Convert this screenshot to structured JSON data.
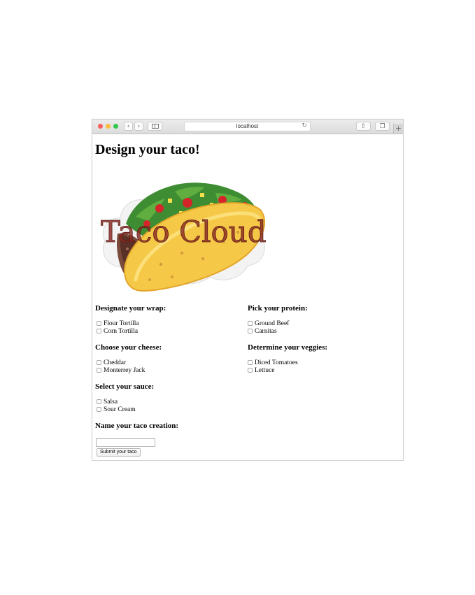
{
  "browser": {
    "address": "localhost",
    "icons": [
      "back-icon",
      "forward-icon",
      "sidebar-icon",
      "reload-icon",
      "share-icon",
      "tabs-icon",
      "new-tab-icon"
    ]
  },
  "page": {
    "title": "Design your taco!",
    "logo_text": "Taco Cloud",
    "sections": {
      "wrap": {
        "heading": "Designate your wrap:",
        "options": [
          "Flour Tortilla",
          "Corn Tortilla"
        ]
      },
      "protein": {
        "heading": "Pick your protein:",
        "options": [
          "Ground Beef",
          "Carnitas"
        ]
      },
      "cheese": {
        "heading": "Choose your cheese:",
        "options": [
          "Cheddar",
          "Monterrey Jack"
        ]
      },
      "veggies": {
        "heading": "Determine your veggies:",
        "options": [
          "Diced Tomatoes",
          "Lettuce"
        ]
      },
      "sauce": {
        "heading": "Select your sauce:",
        "options": [
          "Salsa",
          "Sour Cream"
        ]
      }
    },
    "name_heading": "Name your taco creation:",
    "name_value": "",
    "submit_label": "Submit your taco"
  }
}
